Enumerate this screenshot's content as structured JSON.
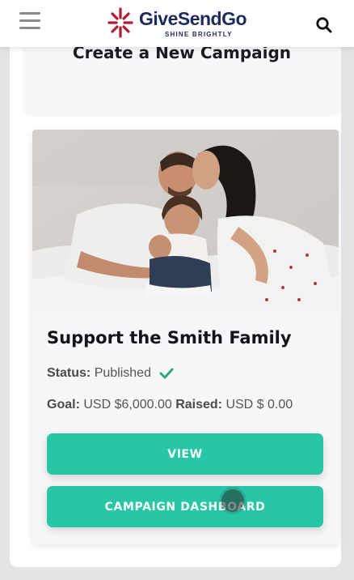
{
  "header": {
    "brand_name": "GiveSendGo",
    "brand_tagline": "SHINE BRIGHTLY",
    "brand_color": "#1f2a5c",
    "brand_accent": "#b31b34"
  },
  "create_section": {
    "title": "Create a New Campaign"
  },
  "campaign": {
    "title": "Support the Smith Family",
    "status_label": "Status:",
    "status_value": "Published",
    "goal_label": "Goal:",
    "goal_value": "USD $6,000.00",
    "raised_label": "Raised:",
    "raised_value": "USD $ 0.00",
    "photo_description": "family-photo",
    "buttons": {
      "view_label": "VIEW",
      "dashboard_label": "CAMPAIGN DASHBOARD"
    }
  },
  "colors": {
    "button": "#27c7a6",
    "check": "#27a87f"
  }
}
